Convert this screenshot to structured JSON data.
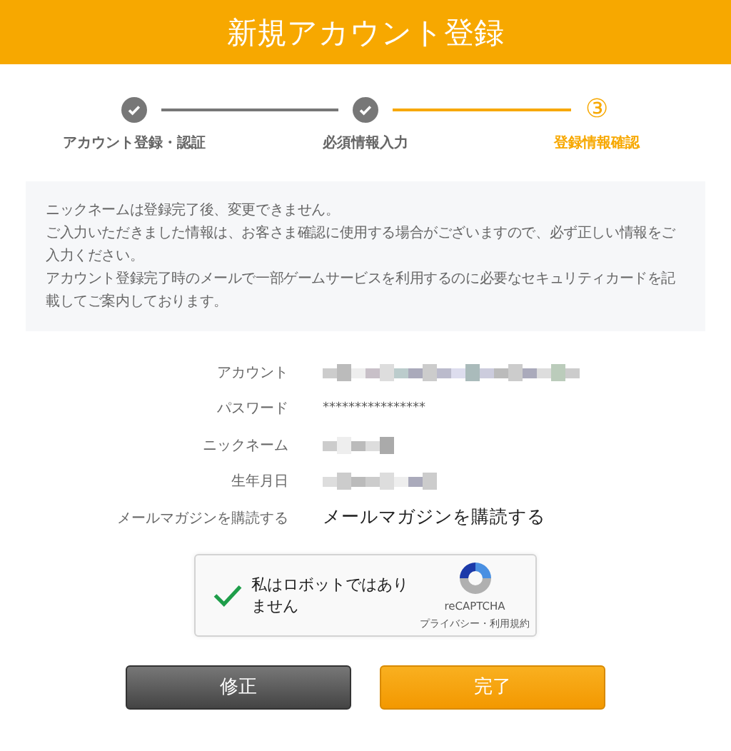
{
  "header": {
    "title": "新規アカウント登録"
  },
  "steps": [
    {
      "label": "アカウント登録・認証",
      "done": true,
      "selected": false
    },
    {
      "label": "必須情報入力",
      "done": true,
      "selected": false
    },
    {
      "label": "登録情報確認",
      "done": false,
      "selected": true,
      "number": "③"
    }
  ],
  "notice": [
    "ニックネームは登録完了後、変更できません。",
    "ご入力いただきました情報は、お客さま確認に使用する場合がございますので、必ず正しい情報をご入力ください。",
    "アカウント登録完了時のメールで一部ゲームサービスを利用するのに必要なセキュリティカードを記載してご案内しております。"
  ],
  "fields": [
    {
      "label": "アカウント",
      "redacted": true
    },
    {
      "label": "パスワード",
      "value": "****************",
      "redacted": false
    },
    {
      "label": "ニックネーム",
      "redacted": true
    },
    {
      "label": "生年月日",
      "redacted": true
    },
    {
      "label": "メールマガジンを購読する",
      "value": "メールマガジンを購読する",
      "redacted": false,
      "large": true
    }
  ],
  "captcha": {
    "checked": true,
    "label": "私はロボットではありません",
    "brand": "reCAPTCHA",
    "links": "プライバシー・利用規約"
  },
  "buttons": [
    {
      "label": "修正",
      "kind": "secondary"
    },
    {
      "label": "完了",
      "kind": "primary"
    }
  ]
}
